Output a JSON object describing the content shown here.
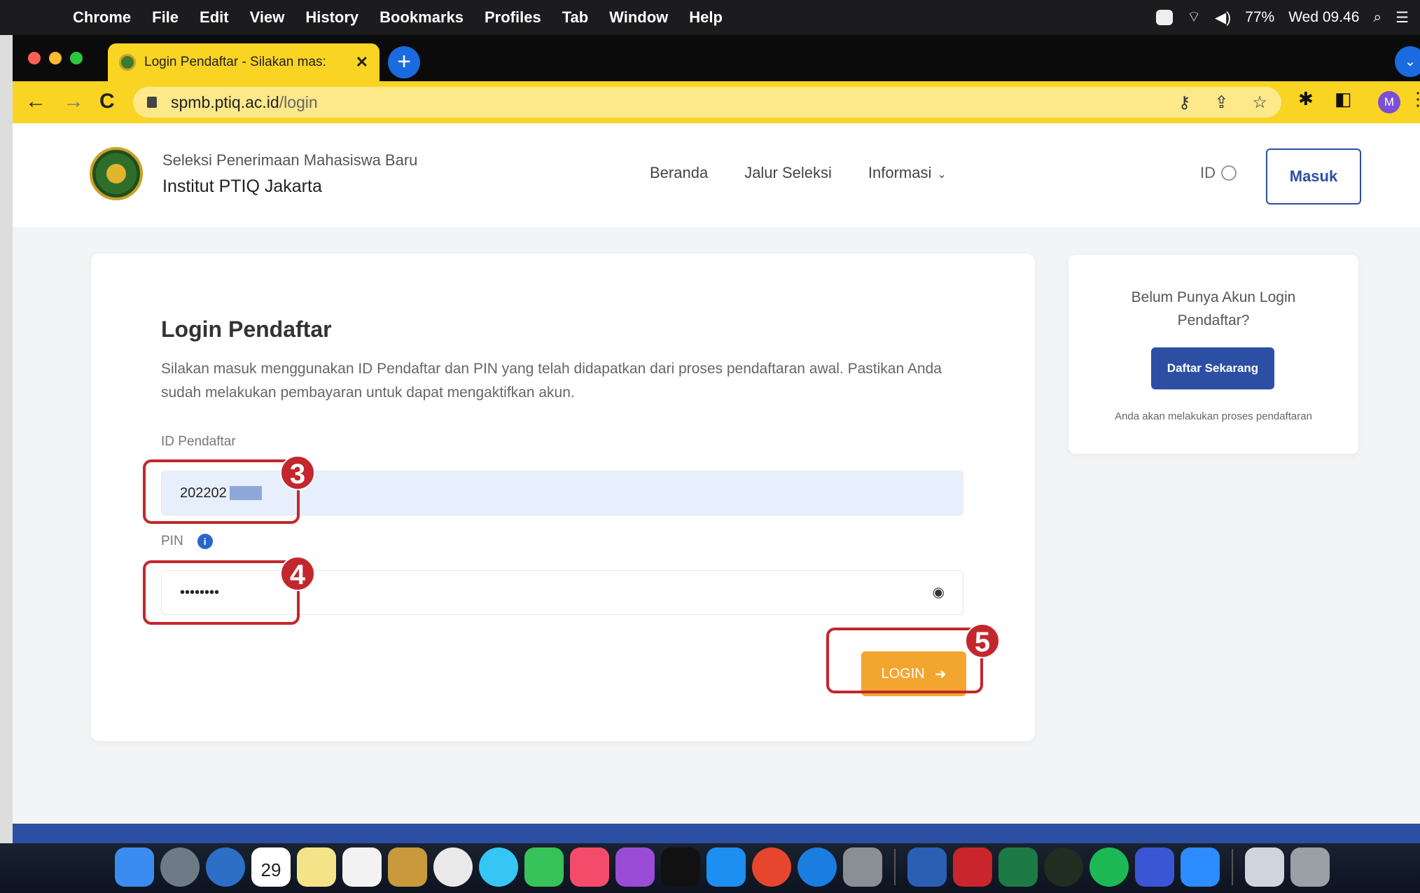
{
  "menubar": {
    "app": "Chrome",
    "items": [
      "File",
      "Edit",
      "View",
      "History",
      "Bookmarks",
      "Profiles",
      "Tab",
      "Window",
      "Help"
    ],
    "battery": "77%",
    "clock": "Wed 09.46"
  },
  "browser": {
    "tab_title": "Login Pendaftar - Silakan mas:",
    "url_host": "spmb.ptiq.ac.id",
    "url_path": "/login",
    "profile_initial": "M"
  },
  "site": {
    "brand_sub": "Seleksi Penerimaan Mahasiswa Baru",
    "brand_main": "Institut PTIQ Jakarta",
    "nav": [
      "Beranda",
      "Jalur Seleksi",
      "Informasi"
    ],
    "lang": "ID",
    "masuk_label": "Masuk"
  },
  "login": {
    "title": "Login Pendaftar",
    "description": "Silakan masuk menggunakan ID Pendaftar dan PIN yang telah didapatkan dari proses pendaftaran awal. Pastikan Anda sudah melakukan pembayaran untuk dapat mengaktifkan akun.",
    "id_label": "ID Pendaftar",
    "id_value": "202202",
    "pin_label": "PIN",
    "pin_value": "••••••••",
    "login_button": "LOGIN"
  },
  "sidebar": {
    "question": "Belum Punya Akun Login Pendaftar?",
    "button": "Daftar Sekarang",
    "note": "Anda akan melakukan proses pendaftaran"
  },
  "annotations": [
    "3",
    "4",
    "5"
  ],
  "dock": {
    "calendar_day": "29"
  },
  "colors": {
    "accent": "#2d4fa3",
    "login_button": "#f3a62f",
    "annotation": "#c3272d",
    "chrome_theme": "#f9d423"
  }
}
